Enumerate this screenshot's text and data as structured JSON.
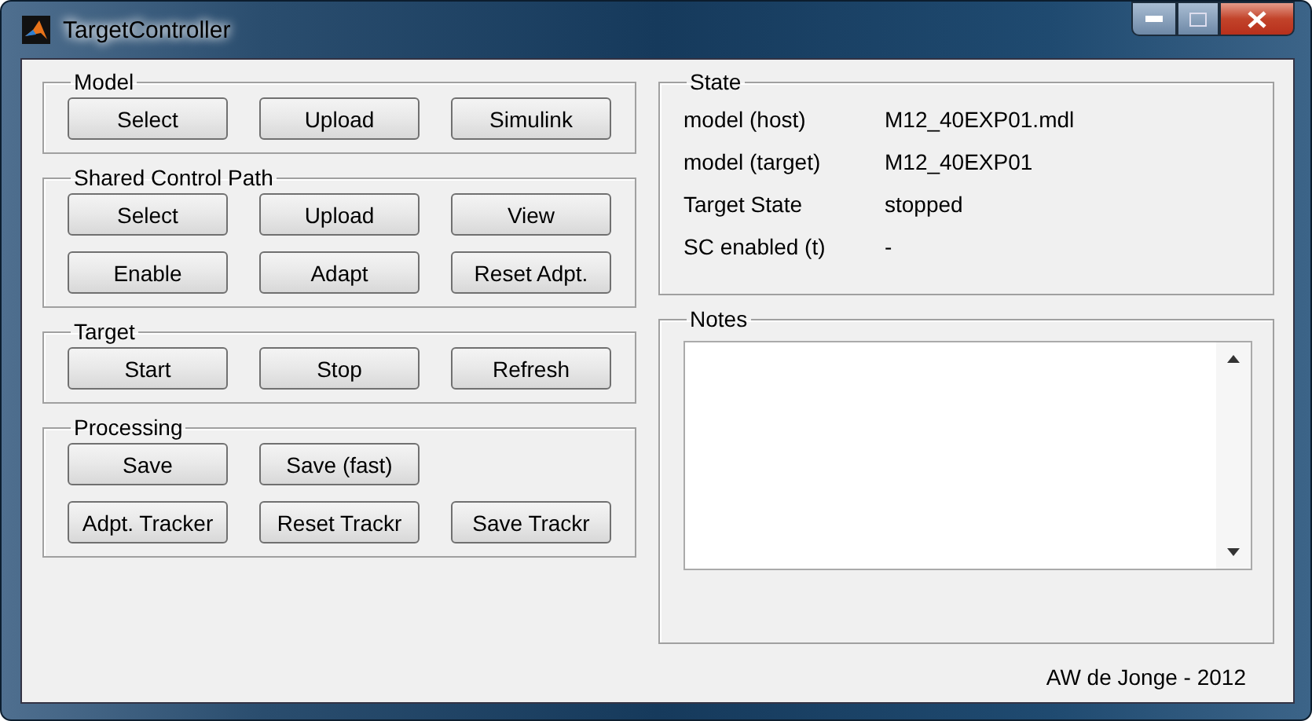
{
  "window": {
    "title": "TargetController"
  },
  "panels": [
    {
      "title": "Model",
      "rows": [
        [
          "Select",
          "Upload",
          "Simulink"
        ]
      ]
    },
    {
      "title": "Shared Control Path",
      "rows": [
        [
          "Select",
          "Upload",
          "View"
        ],
        [
          "Enable",
          "Adapt",
          "Reset Adpt."
        ]
      ]
    },
    {
      "title": "Target",
      "rows": [
        [
          "Start",
          "Stop",
          "Refresh"
        ]
      ]
    },
    {
      "title": "Processing",
      "rows": [
        [
          "Save",
          "Save (fast)"
        ],
        [
          "Adpt. Tracker",
          "Reset Trackr",
          "Save Trackr"
        ]
      ]
    }
  ],
  "state": {
    "title": "State",
    "rows": [
      {
        "label": "model (host)",
        "value": "M12_40EXP01.mdl"
      },
      {
        "label": "model (target)",
        "value": "M12_40EXP01"
      },
      {
        "label": "Target State",
        "value": "stopped"
      },
      {
        "label": "SC enabled (t)",
        "value": "-"
      }
    ]
  },
  "notes": {
    "title": "Notes"
  },
  "footer": "AW de Jonge - 2012"
}
